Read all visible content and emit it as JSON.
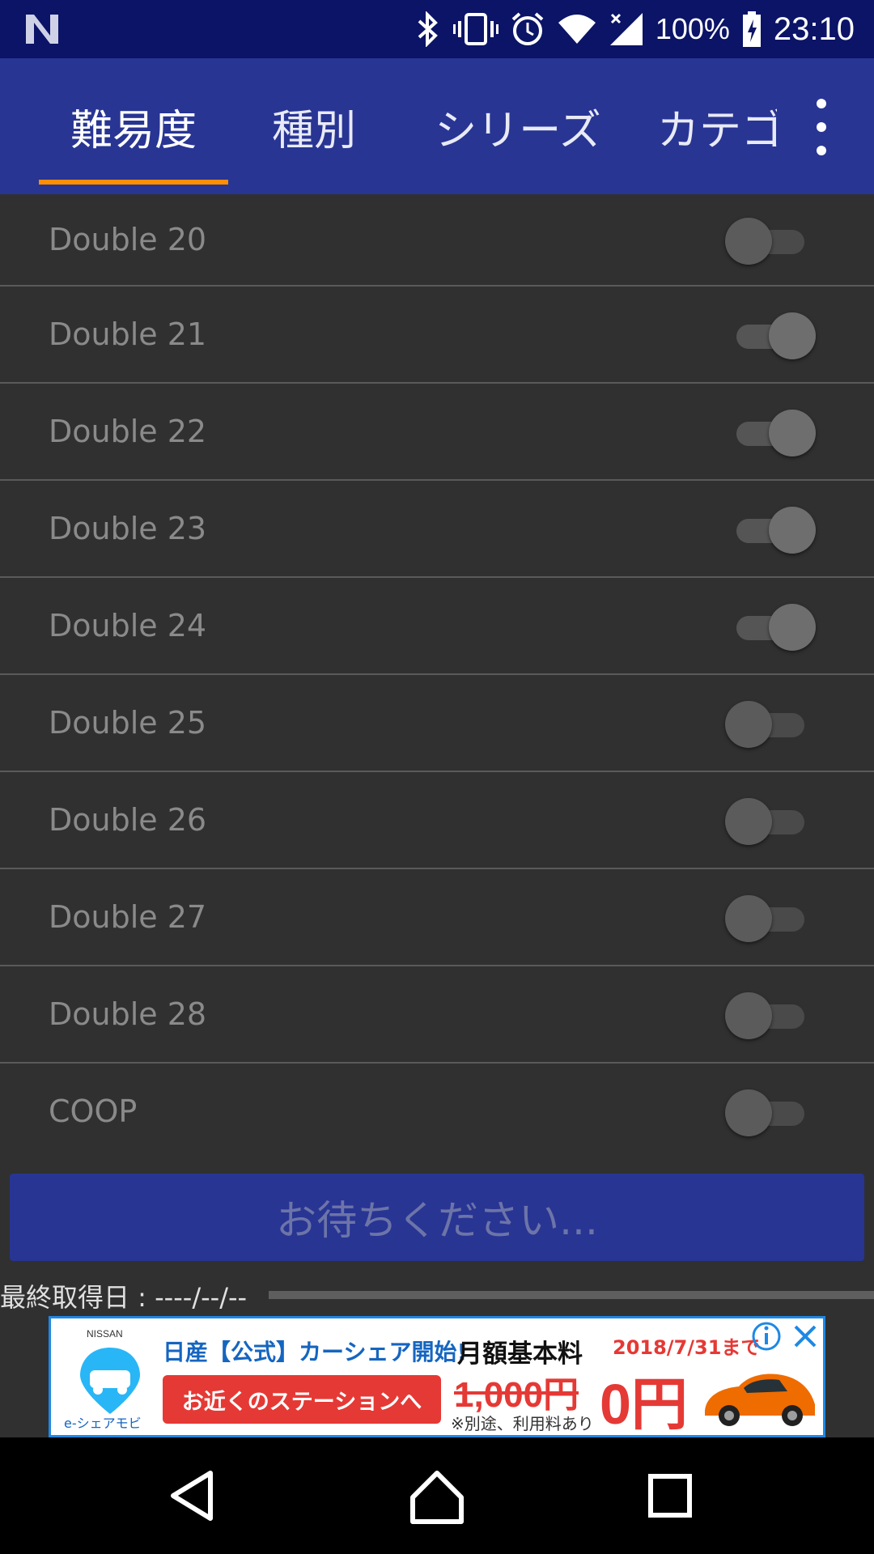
{
  "status_bar": {
    "battery": "100%",
    "time": "23:10",
    "icons": [
      "notification-n-icon",
      "bluetooth-icon",
      "vibrate-icon",
      "alarm-icon",
      "wifi-icon",
      "signal-icon",
      "battery-charging-icon"
    ]
  },
  "tabs": [
    {
      "label": "難易度",
      "active": true
    },
    {
      "label": "種別",
      "active": false
    },
    {
      "label": "シリーズ",
      "active": false
    },
    {
      "label": "カテゴ",
      "active": false
    }
  ],
  "overflow_icon": "more-vertical-icon",
  "list": [
    {
      "label": "Double 20",
      "on": false
    },
    {
      "label": "Double 21",
      "on": true
    },
    {
      "label": "Double 22",
      "on": true
    },
    {
      "label": "Double 23",
      "on": true
    },
    {
      "label": "Double 24",
      "on": true
    },
    {
      "label": "Double 25",
      "on": false
    },
    {
      "label": "Double 26",
      "on": false
    },
    {
      "label": "Double 27",
      "on": false
    },
    {
      "label": "Double 28",
      "on": false
    },
    {
      "label": "COOP",
      "on": false
    }
  ],
  "wait_button": "お待ちください...",
  "last_fetch": "最終取得日 : ----/--/--",
  "progress_fraction": 0.0,
  "ad": {
    "small_logo": "NISSAN",
    "brand": "e-シェアモビ",
    "headline": "日産【公式】カーシェア開始!",
    "price_label": "月額基本料",
    "deadline": "2018/7/31まで",
    "cta": "お近くのステーションへ",
    "old_price": "1,000円",
    "new_price": "0円",
    "note": "※別途、利用料あり"
  },
  "nav": [
    "back-icon",
    "home-icon",
    "recents-icon"
  ]
}
